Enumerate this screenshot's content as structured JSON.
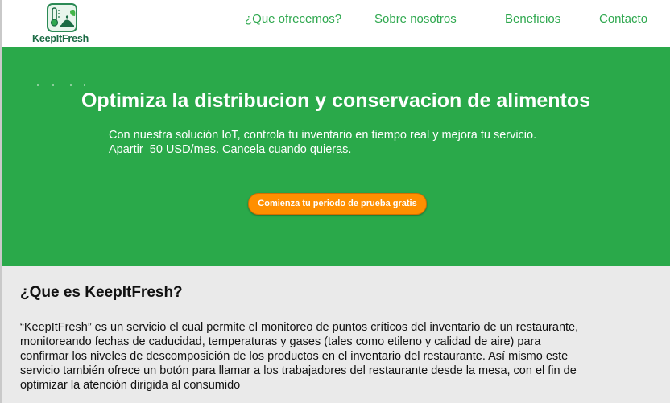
{
  "header": {
    "brand": "KeepItFresh",
    "nav": [
      "¿Que ofrecemos?",
      "Sobre nosotros",
      "Beneficios",
      "Contacto"
    ]
  },
  "hero": {
    "title": "Optimiza la distribucion y conservacion de alimentos",
    "description_lines": [
      "Con nuestra solución IoT, controla tu inventario en tiempo real y mejora tu servicio.",
      "Apartir  50 USD/mes. Cancela cuando quieras."
    ],
    "cta_label": "Comienza tu periodo de prueba gratis"
  },
  "about": {
    "title": "¿Que es KeepItFresh?",
    "paragraph_lines": [
      "“KeepItFresh” es un servicio el cual permite el monitoreo de puntos críticos del inventario de un restaurante,",
      "monitoreando fechas de caducidad, temperaturas y gases (tales como etileno y calidad de aire) para",
      "confirmar los niveles de descomposición de los productos en el inventario del restaurante. Así mismo este",
      "servicio también ofrece un botón para llamar a los trabajadores del restaurante desde la mesa, con el fin de",
      "optimizar la atención dirigida al consumido"
    ]
  },
  "colors": {
    "hero_green": "#2aa94a",
    "nav_green": "#2fa84f",
    "brand_dark_green": "#1b6b44",
    "cta_orange": "#ff8f00",
    "about_gray": "#eaeaea"
  },
  "icons": [
    "keepitfresh-logo-icon"
  ]
}
